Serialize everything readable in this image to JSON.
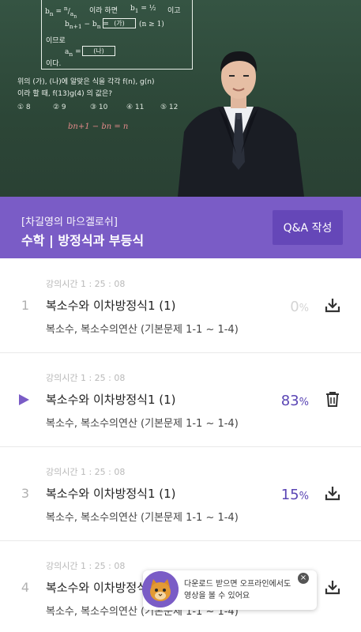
{
  "video": {
    "board": {
      "line1_a": "b",
      "line1_b": "이라 하면",
      "line1_c": "이고",
      "line2_a": "b",
      "line2_box": "(가)",
      "line2_cond": "(n ≥ 1)",
      "line3": "이므로",
      "line4_a": "a",
      "line4_box": "(나)",
      "line5": "이다.",
      "q1": "위의 (가), (나)에 알맞은 식을 각각 f(n), g(n)",
      "q2": "이라 할 때, f(13)g(4) 의 값은?",
      "choices": [
        "① 8",
        "② 9",
        "③ 10",
        "④ 11",
        "⑤ 12"
      ],
      "chalk": "bn+1 − bn = n"
    }
  },
  "header": {
    "subtitle": "[차길영의 마으겔로쉬]",
    "title": "수학 | 방정식과 부등식",
    "qa_button": "Q&A 작성"
  },
  "lectures": [
    {
      "time": "강의시간 1 : 25 : 08",
      "index": "1",
      "title": "복소수와 이차방정식1 (1)",
      "subtitle": "복소수, 복소수의연산 (기본문제 1-1 ~ 1-4)",
      "progress": "0",
      "unit": "%",
      "state": "download",
      "active": false
    },
    {
      "time": "강의시간 1 : 25 : 08",
      "index": "",
      "title": "복소수와 이차방정식1 (1)",
      "subtitle": "복소수, 복소수의연산 (기본문제 1-1 ~ 1-4)",
      "progress": "83",
      "unit": "%",
      "state": "delete",
      "active": true
    },
    {
      "time": "강의시간 1 : 25 : 08",
      "index": "3",
      "title": "복소수와 이차방정식1 (1)",
      "subtitle": "복소수, 복소수의연산 (기본문제 1-1 ~ 1-4)",
      "progress": "15",
      "unit": "%",
      "state": "download",
      "active": false
    },
    {
      "time": "강의시간 1 : 25 : 08",
      "index": "4",
      "title": "복소수와 이차방정식1 (1)",
      "subtitle": "복소수, 복소수의연산 (기본문제 1-1 ~ 1-4)",
      "progress": "",
      "unit": "",
      "state": "download",
      "active": false
    }
  ],
  "toast": {
    "line1": "다운로드 받으면 오프라인에서도",
    "line2": "영상을 볼 수 있어요",
    "close_icon": "close-icon"
  },
  "colors": {
    "accent": "#7a5cc6",
    "accent_dark": "#6547b8",
    "progress_active": "#5a45b4"
  }
}
